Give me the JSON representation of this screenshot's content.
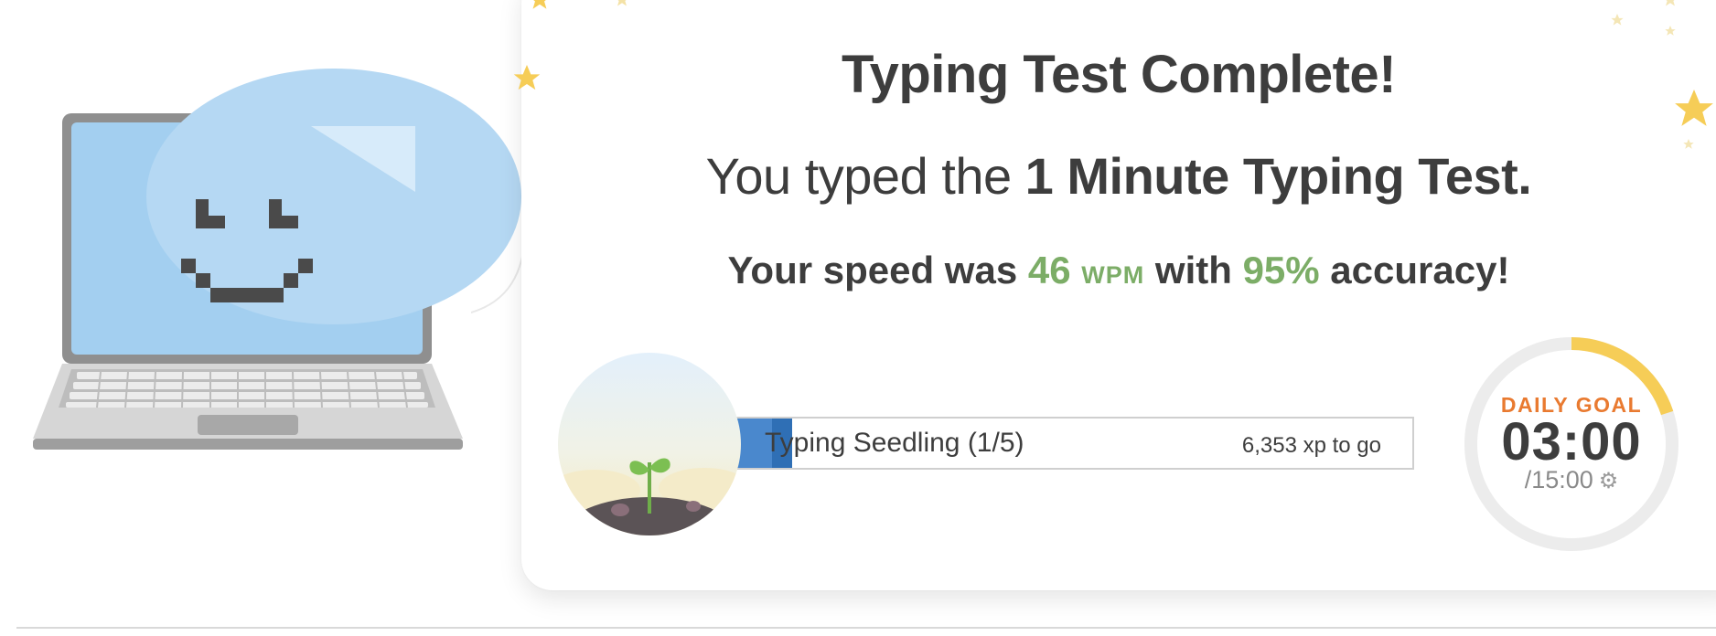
{
  "result": {
    "title": "Typing Test Complete!",
    "subtitle_prefix": "You typed the ",
    "test_name": "1 Minute Typing Test.",
    "speed_prefix": "Your speed was ",
    "wpm_value": "46",
    "wpm_unit": "WPM",
    "speed_middle": " with ",
    "accuracy_value": "95%",
    "speed_suffix": " accuracy!"
  },
  "level": {
    "name": "Typing Seedling (1/5)",
    "xp_to_go": "6,353 xp to go",
    "progress_fraction": 0.08
  },
  "daily_goal": {
    "label": "DAILY GOAL",
    "time": "03:00",
    "total": "/15:00",
    "progress_fraction": 0.2
  },
  "icons": {
    "mascot": "smiling-laptop-icon",
    "badge": "seedling-badge-icon",
    "settings": "gear-icon",
    "decor": "star-icon"
  },
  "colors": {
    "accent_green": "#7cad67",
    "accent_orange": "#e97a30",
    "progress_blue": "#4a88cd",
    "goal_yellow": "#f6cd57",
    "screen_blue": "#a3cff0"
  }
}
